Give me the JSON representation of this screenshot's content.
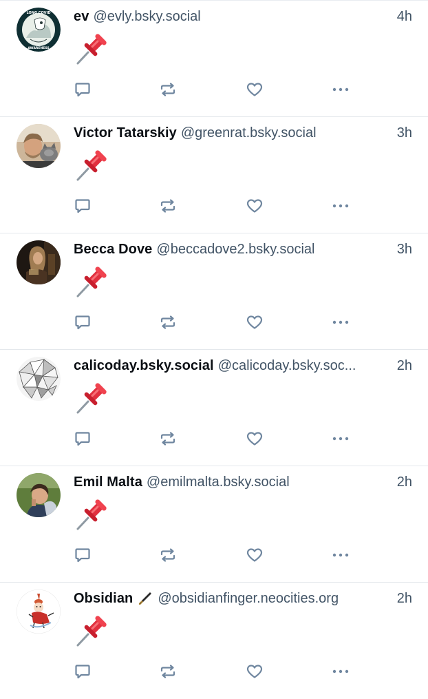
{
  "feed": {
    "posts": [
      {
        "display_name": "ev",
        "handle": "@evly.bsky.social",
        "time": "4h",
        "content": "📌",
        "avatar": "long-covid-awareness-avatar",
        "avatar_text": "LONG COVID AWARENESS"
      },
      {
        "display_name": "Victor Tatarskiy",
        "handle": "@greenrat.bsky.social",
        "time": "3h",
        "content": "📌",
        "avatar": "man-with-cat-photo-avatar"
      },
      {
        "display_name": "Becca Dove",
        "handle": "@beccadove2.bsky.social",
        "time": "3h",
        "content": "📌",
        "avatar": "dark-portrait-photo-avatar"
      },
      {
        "display_name": "calicoday.bsky.social",
        "handle": "@calicoday.bsky.soc...",
        "time": "2h",
        "content": "📌",
        "avatar": "triangle-mosaic-avatar"
      },
      {
        "display_name": "Emil Malta",
        "handle": "@emilmalta.bsky.social",
        "time": "2h",
        "content": "📌",
        "avatar": "outdoor-photo-avatar"
      },
      {
        "display_name": "Obsidian",
        "handle": "@obsidianfinger.neocities.org",
        "time": "2h",
        "content": "📌",
        "avatar": "little-my-cartoon-avatar",
        "name_emoji": "fountain-pen-icon"
      }
    ]
  },
  "icons": {
    "reply": "speech-bubble-icon",
    "repost": "repost-arrows-icon",
    "like": "heart-outline-icon",
    "more": "three-dots-icon",
    "pin": "pushpin-emoji"
  },
  "colors": {
    "name": "#0b0f14",
    "handle": "#425466",
    "icon": "#6f869f",
    "divider": "#e4e8ec",
    "pin_red": "#e1303f"
  }
}
